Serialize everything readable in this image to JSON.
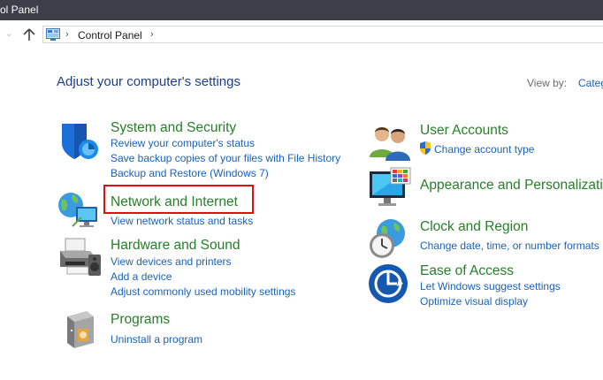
{
  "window": {
    "title": "ol Panel"
  },
  "address": {
    "crumb": "Control Panel"
  },
  "main": {
    "heading": "Adjust your computer's settings",
    "view_by_label": "View by:",
    "view_by_value": "Categ"
  },
  "categories": {
    "system_security": {
      "title": "System and Security",
      "links": [
        "Review your computer's status",
        "Save backup copies of your files with File History",
        "Backup and Restore (Windows 7)"
      ]
    },
    "network": {
      "title": "Network and Internet",
      "links": [
        "View network status and tasks"
      ]
    },
    "hardware": {
      "title": "Hardware and Sound",
      "links": [
        "View devices and printers",
        "Add a device",
        "Adjust commonly used mobility settings"
      ]
    },
    "programs": {
      "title": "Programs",
      "links": [
        "Uninstall a program"
      ]
    },
    "user_accounts": {
      "title": "User Accounts",
      "links": [
        "Change account type"
      ]
    },
    "appearance": {
      "title": "Appearance and Personalizatio",
      "links": []
    },
    "clock": {
      "title": "Clock and Region",
      "links": [
        "Change date, time, or number formats"
      ]
    },
    "ease": {
      "title": "Ease of Access",
      "links": [
        "Let Windows suggest settings",
        "Optimize visual display"
      ]
    }
  },
  "icons": {
    "system_security": "shield-icon",
    "network": "globe-network-icon",
    "hardware": "printer-icon",
    "programs": "programs-box-icon",
    "user_accounts": "users-icon",
    "appearance": "monitor-icon",
    "clock": "clock-globe-icon",
    "ease": "ease-of-access-icon",
    "uac": "uac-shield-icon"
  },
  "colors": {
    "title_green": "#267f28",
    "link_blue": "#1a62b8",
    "heading_blue": "#1e3e87",
    "highlight_red": "#e01010"
  }
}
